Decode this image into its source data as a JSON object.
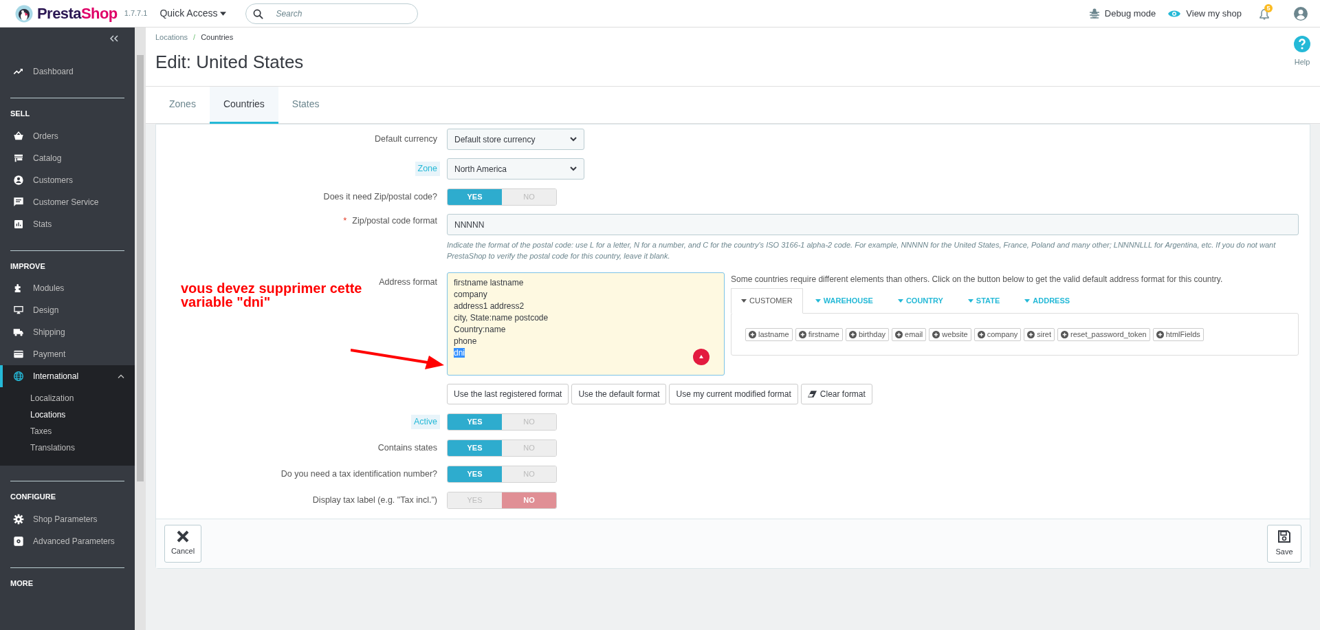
{
  "header": {
    "logo_part_1": "Presta",
    "logo_part_2": "Shop",
    "version": "1.7.7.1",
    "quick_access": "Quick Access",
    "search": {
      "placeholder": "Search"
    },
    "debug_mode": "Debug mode",
    "view_shop": "View my shop",
    "notification_count": "5"
  },
  "sidebar": {
    "sections": [
      {
        "items": [
          {
            "label": "Dashboard",
            "selected": false,
            "expanded": false
          }
        ]
      },
      {
        "title": "SELL",
        "items": [
          {
            "label": "Orders",
            "selected": false,
            "expanded": false
          },
          {
            "label": "Catalog",
            "selected": false,
            "expanded": false
          },
          {
            "label": "Customers",
            "selected": false,
            "expanded": false
          },
          {
            "label": "Customer Service",
            "selected": false,
            "expanded": false
          },
          {
            "label": "Stats",
            "selected": false,
            "expanded": false
          }
        ]
      },
      {
        "title": "IMPROVE",
        "items": [
          {
            "label": "Modules",
            "selected": false,
            "expanded": false
          },
          {
            "label": "Design",
            "selected": false,
            "expanded": false
          },
          {
            "label": "Shipping",
            "selected": false,
            "expanded": false
          },
          {
            "label": "Payment",
            "selected": false,
            "expanded": false
          },
          {
            "label": "International",
            "selected": true,
            "expanded": true,
            "children": [
              {
                "label": "Localization",
                "selected": false
              },
              {
                "label": "Locations",
                "selected": true
              },
              {
                "label": "Taxes",
                "selected": false
              },
              {
                "label": "Translations",
                "selected": false
              }
            ]
          }
        ]
      },
      {
        "title": "CONFIGURE",
        "items": [
          {
            "label": "Shop Parameters",
            "selected": false,
            "expanded": false
          },
          {
            "label": "Advanced Parameters",
            "selected": false,
            "expanded": false
          }
        ]
      },
      {
        "title": "MORE"
      }
    ]
  },
  "page": {
    "breadcrumb": [
      "Locations",
      "Countries"
    ],
    "breadcrumb_separator": "/",
    "title": "Edit: United States",
    "help": "Help",
    "tabs": [
      {
        "label": "Zones",
        "selected": false
      },
      {
        "label": "Countries",
        "selected": true
      },
      {
        "label": "States",
        "selected": false
      }
    ]
  },
  "form": {
    "fields": [
      {
        "kind": "select",
        "label": "Default currency",
        "highlighted": false,
        "value": "Default store currency"
      },
      {
        "kind": "select",
        "label": "Zone",
        "highlighted": true,
        "value": "North America"
      },
      {
        "kind": "toggle",
        "label": "Does it need Zip/postal code?",
        "highlighted": false,
        "on": true,
        "yes": "YES",
        "no": "NO"
      },
      {
        "kind": "text",
        "label": "Zip/postal code format",
        "highlighted": false,
        "required_mark": "*",
        "value": "NNNNN",
        "hint": "Indicate the format of the postal code: use L for a letter, N for a number, and C for the country's ISO 3166-1 alpha-2 code. For example, NNNNN for the United States, France, Poland and many other; LNNNNLLL for Argentina, etc. If you do not want PrestaShop to verify the postal code for this country, leave it blank."
      },
      {
        "kind": "address",
        "label": "Address format",
        "highlighted": false,
        "lines": [
          {
            "text": "firstname lastname",
            "selected": false
          },
          {
            "text": "company",
            "selected": false
          },
          {
            "text": "address1 address2",
            "selected": false
          },
          {
            "text": "city, State:name postcode",
            "selected": false
          },
          {
            "text": "Country:name",
            "selected": false
          },
          {
            "text": "phone",
            "selected": false
          },
          {
            "text": "dni",
            "selected": true
          }
        ],
        "intro": "Some countries require different elements than others. Click on the button below to get the valid default address format for this country.",
        "tabs": [
          {
            "label": "CUSTOMER",
            "selected": true
          },
          {
            "label": "WAREHOUSE",
            "selected": false
          },
          {
            "label": "COUNTRY",
            "selected": false
          },
          {
            "label": "STATE",
            "selected": false
          },
          {
            "label": "ADDRESS",
            "selected": false
          }
        ],
        "tags": [
          "lastname",
          "firstname",
          "birthday",
          "email",
          "website",
          "company",
          "siret",
          "reset_password_token",
          "htmlFields"
        ],
        "buttons": [
          {
            "kind": "format",
            "label": "Use the last registered format"
          },
          {
            "kind": "format",
            "label": "Use the default format"
          },
          {
            "kind": "format",
            "label": "Use my current modified format"
          },
          {
            "kind": "clear",
            "label": "Clear format"
          }
        ]
      },
      {
        "kind": "toggle",
        "label": "Active",
        "highlighted": true,
        "on": true,
        "yes": "YES",
        "no": "NO"
      },
      {
        "kind": "toggle",
        "label": "Contains states",
        "highlighted": false,
        "on": true,
        "yes": "YES",
        "no": "NO"
      },
      {
        "kind": "toggle",
        "label": "Do you need a tax identification number?",
        "highlighted": false,
        "on": true,
        "yes": "YES",
        "no": "NO"
      },
      {
        "kind": "toggle",
        "label": "Display tax label (e.g. \"Tax incl.\")",
        "highlighted": false,
        "on": false,
        "yes": "YES",
        "no": "NO"
      }
    ],
    "cancel": "Cancel",
    "save": "Save"
  },
  "annotation": {
    "text": "vous devez supprimer cette variable \"dni\""
  }
}
